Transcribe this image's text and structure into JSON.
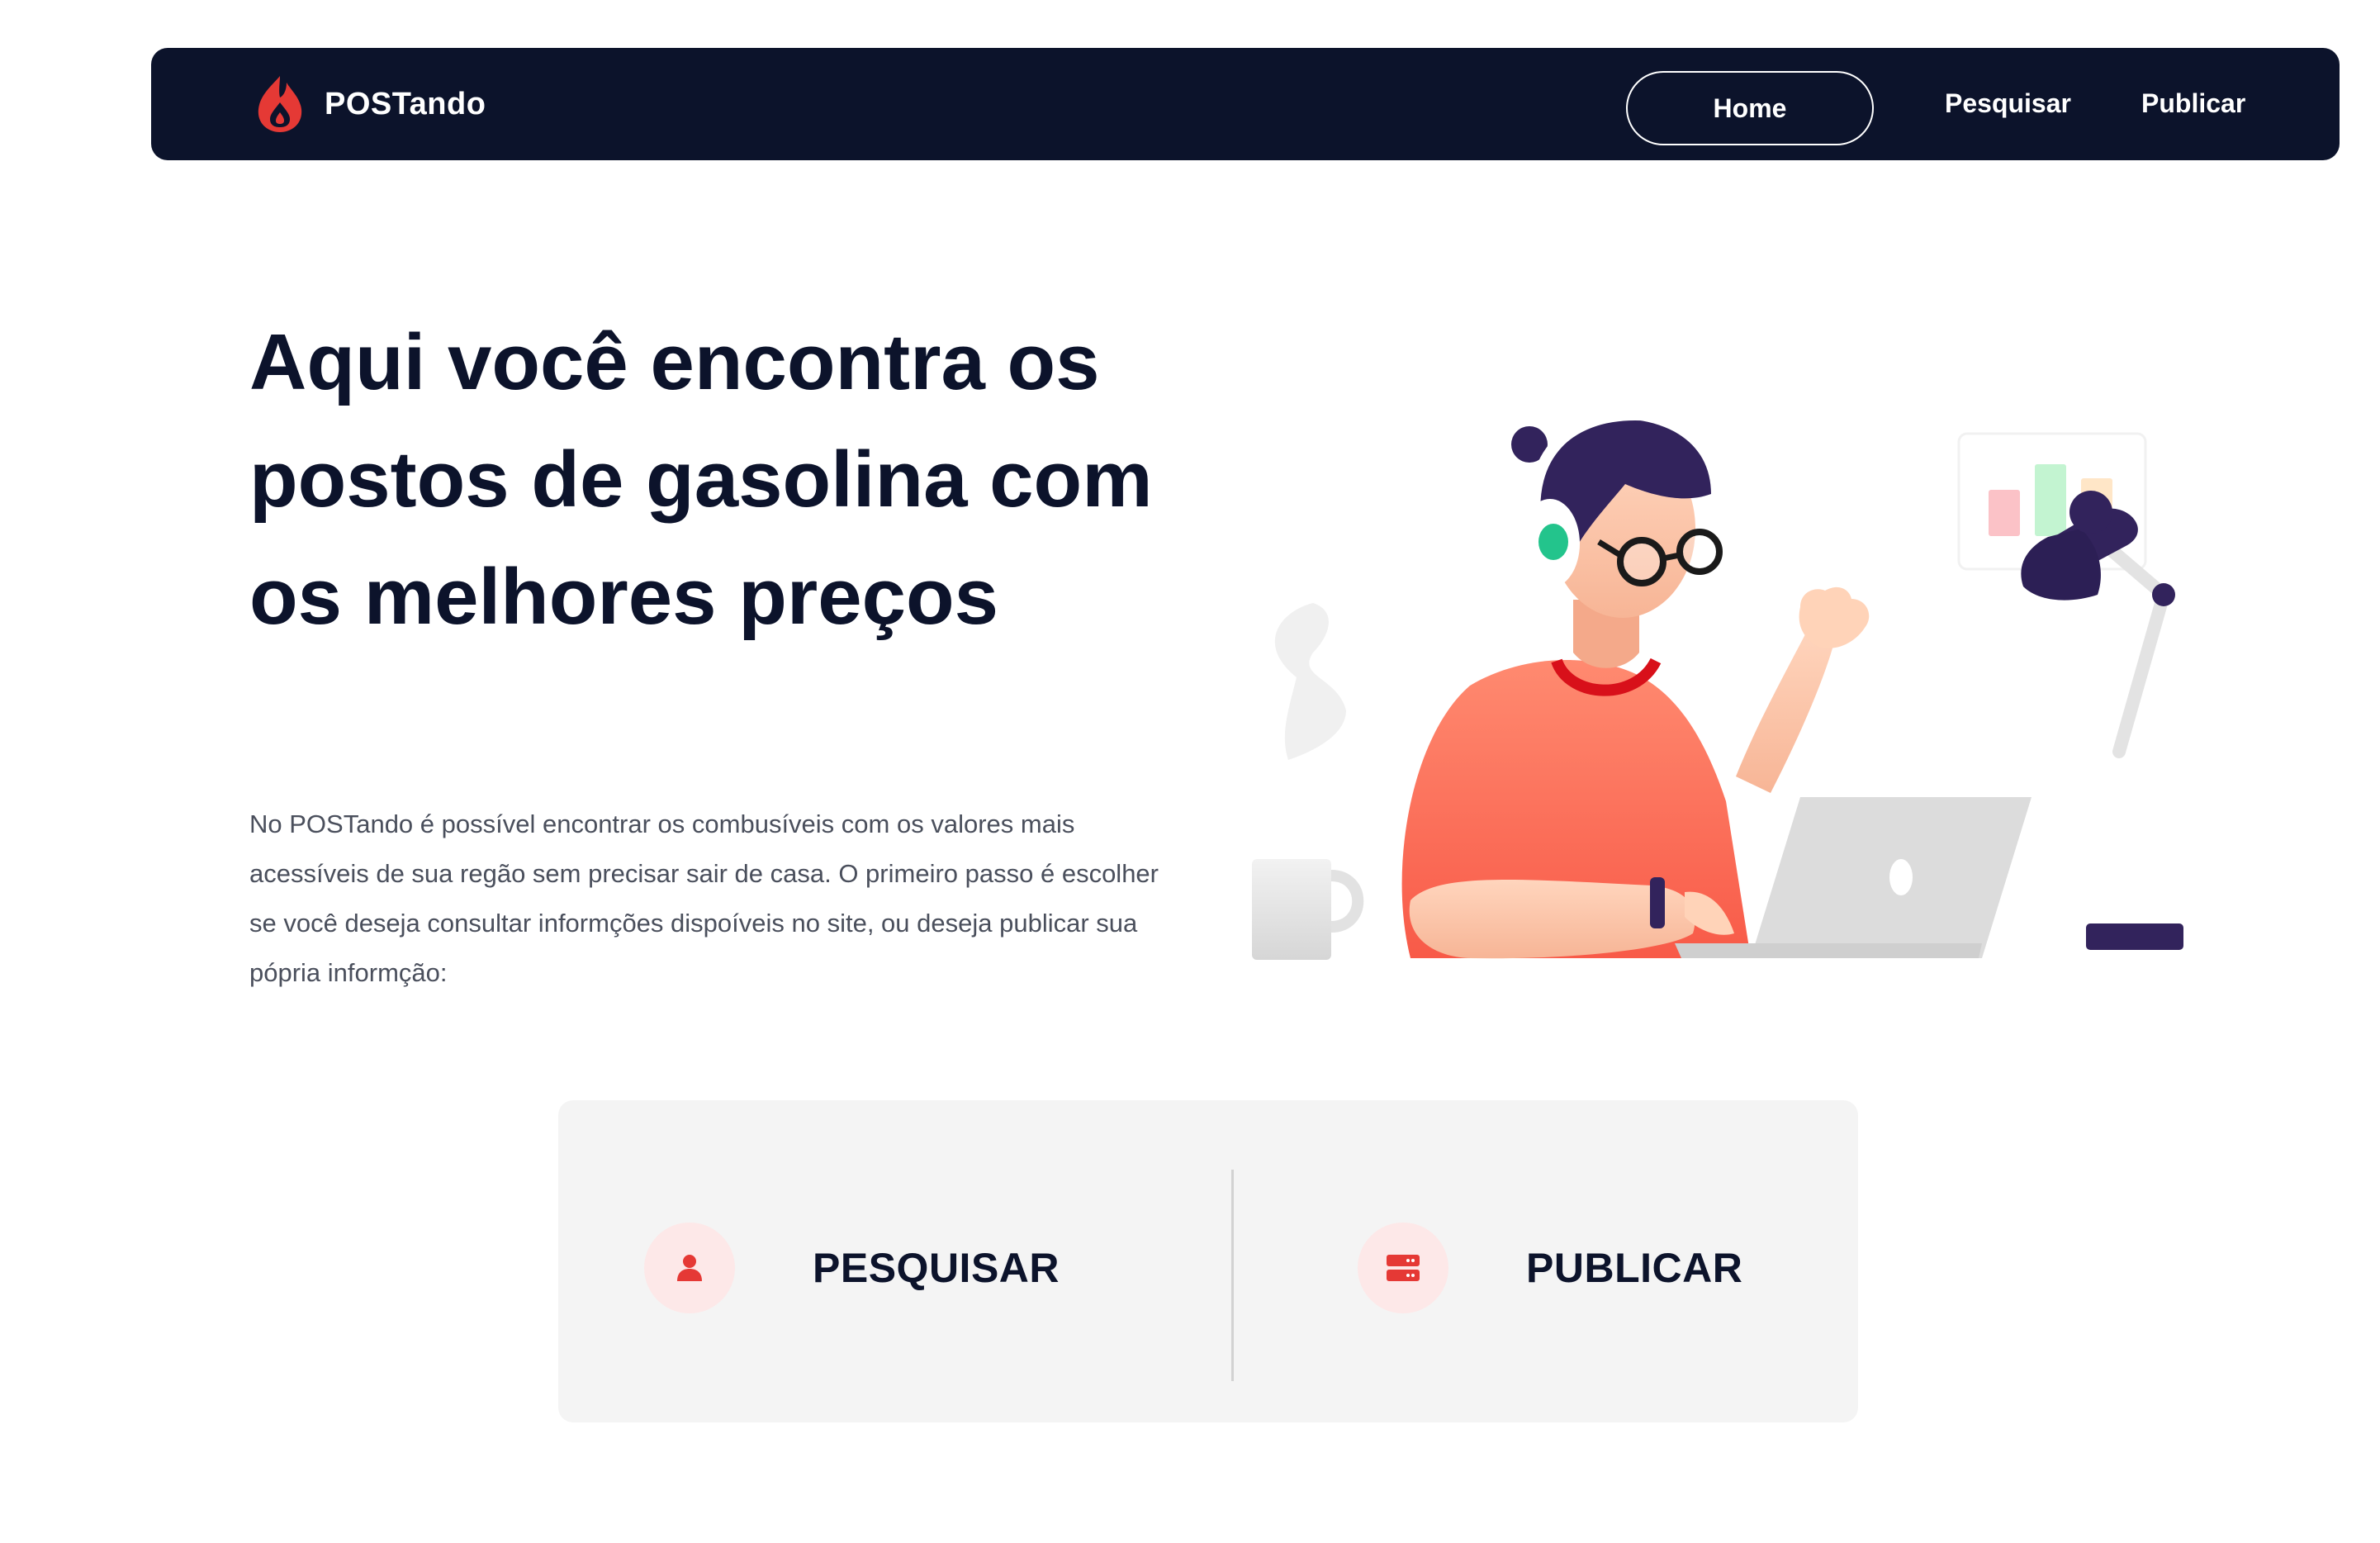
{
  "navbar": {
    "brand_name": "POSTando",
    "brand_icon": "flame-logo-icon",
    "home_label": "Home",
    "pesquisar_label": "Pesquisar",
    "publicar_label": "Publicar"
  },
  "hero": {
    "title": "Aqui você encontra os postos de gasolina com os melhores preços",
    "description": "No POSTando é possível encontrar os combusíveis com os valores mais acessíveis de sua regão sem precisar sair de casa. O primeiro passo é escolher se você deseja consultar informções dispoíveis no site, ou deseja publicar sua pópria informção:",
    "illustration": "person-with-headphones-at-laptop-illustration"
  },
  "actions": {
    "pesquisar": {
      "label": "PESQUISAR",
      "icon": "user-icon"
    },
    "publicar": {
      "label": "PUBLICAR",
      "icon": "server-icon"
    }
  },
  "colors": {
    "navy": "#0c132b",
    "accent_red": "#e53935",
    "icon_bg": "#fde8e8",
    "card_bg": "#f4f4f4"
  }
}
